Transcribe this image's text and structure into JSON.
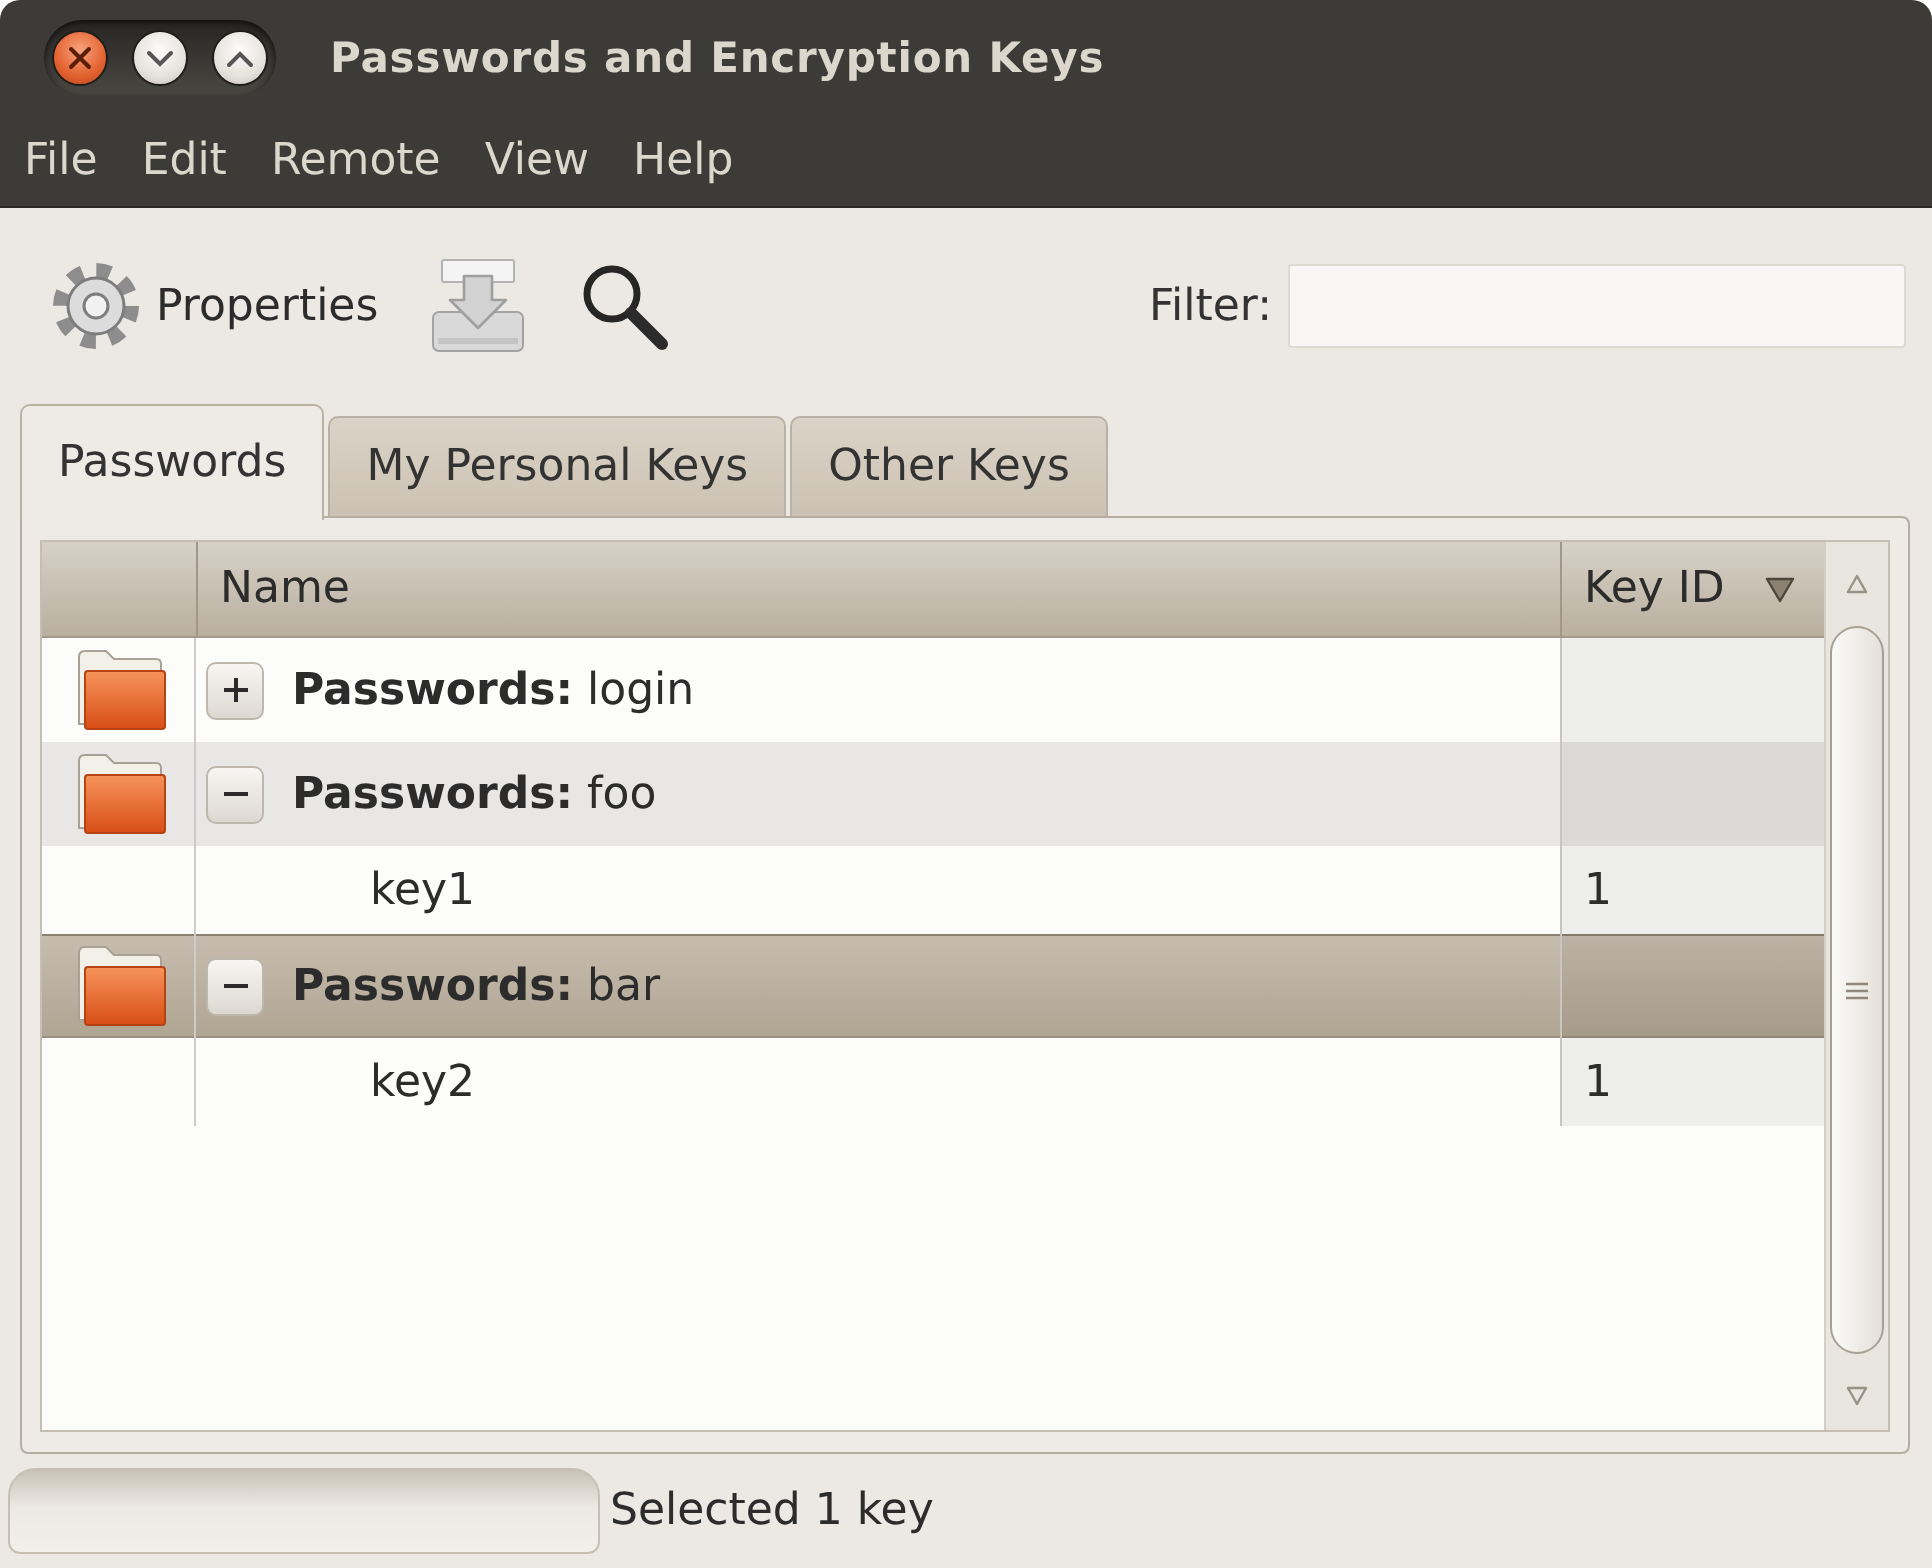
{
  "window": {
    "title": "Passwords and Encryption Keys"
  },
  "menu": [
    "File",
    "Edit",
    "Remote",
    "View",
    "Help"
  ],
  "toolbar": [
    {
      "kind": "properties",
      "label": "Properties"
    },
    {
      "kind": "import"
    },
    {
      "kind": "find"
    }
  ],
  "filter": {
    "label": "Filter:"
  },
  "tabs": [
    {
      "label": "Passwords",
      "selected": true
    },
    {
      "label": "My Personal Keys",
      "selected": false
    },
    {
      "label": "Other Keys",
      "selected": false
    }
  ],
  "table": {
    "columns": [
      {
        "label": "Name",
        "sorted": false
      },
      {
        "label": "Key ID",
        "sorted": true
      }
    ],
    "rows": [
      {
        "name": "**Passwords:** login",
        "expanded": false,
        "selected": false
      },
      {
        "name": "**Passwords:** foo",
        "expanded": true,
        "selected": false,
        "children": [
          {
            "name": "key1",
            "key_id": "1",
            "selected": false
          }
        ]
      },
      {
        "name": "**Passwords:** bar",
        "expanded": true,
        "selected": true,
        "children": [
          {
            "name": "key2",
            "key_id": "1",
            "selected": false
          }
        ]
      }
    ]
  },
  "status_bar": {
    "text": "Selected 1 key"
  }
}
